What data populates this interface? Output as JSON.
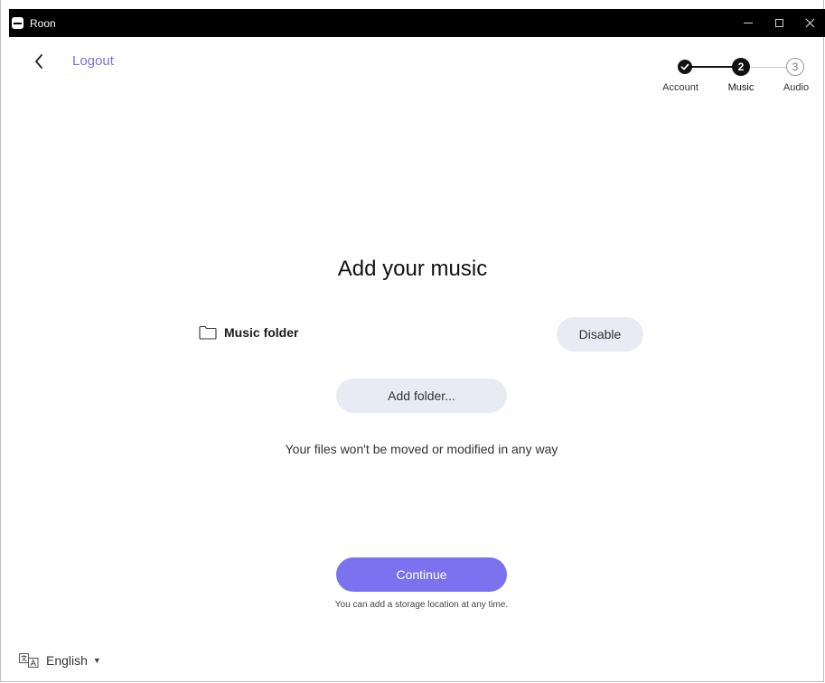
{
  "window": {
    "title": "Roon",
    "icon": "roon-app-icon",
    "controls": [
      "minimize-icon",
      "maximize-icon",
      "close-icon"
    ]
  },
  "nav": {
    "back_icon": "chevron-left-icon",
    "logout_label": "Logout"
  },
  "stepper": {
    "steps": [
      {
        "label": "Account",
        "state": "completed",
        "marker": "✓"
      },
      {
        "label": "Music",
        "state": "current",
        "marker": "2"
      },
      {
        "label": "Audio",
        "state": "upcoming",
        "marker": "3"
      }
    ]
  },
  "main": {
    "heading": "Add your music",
    "folder": {
      "icon": "folder-icon",
      "name": "Music folder",
      "action_label": "Disable"
    },
    "add_folder_label": "Add folder...",
    "note": "Your files won't be moved or modified in any way",
    "continue_label": "Continue",
    "subnote": "You can add a storage location at any time."
  },
  "language": {
    "icon": "translate-icon",
    "label": "English",
    "caret": "▼"
  },
  "colors": {
    "accent": "#7b72f0",
    "link": "#7b6fe3",
    "pill_bg": "#e8ebf3",
    "titlebar": "#000000"
  }
}
